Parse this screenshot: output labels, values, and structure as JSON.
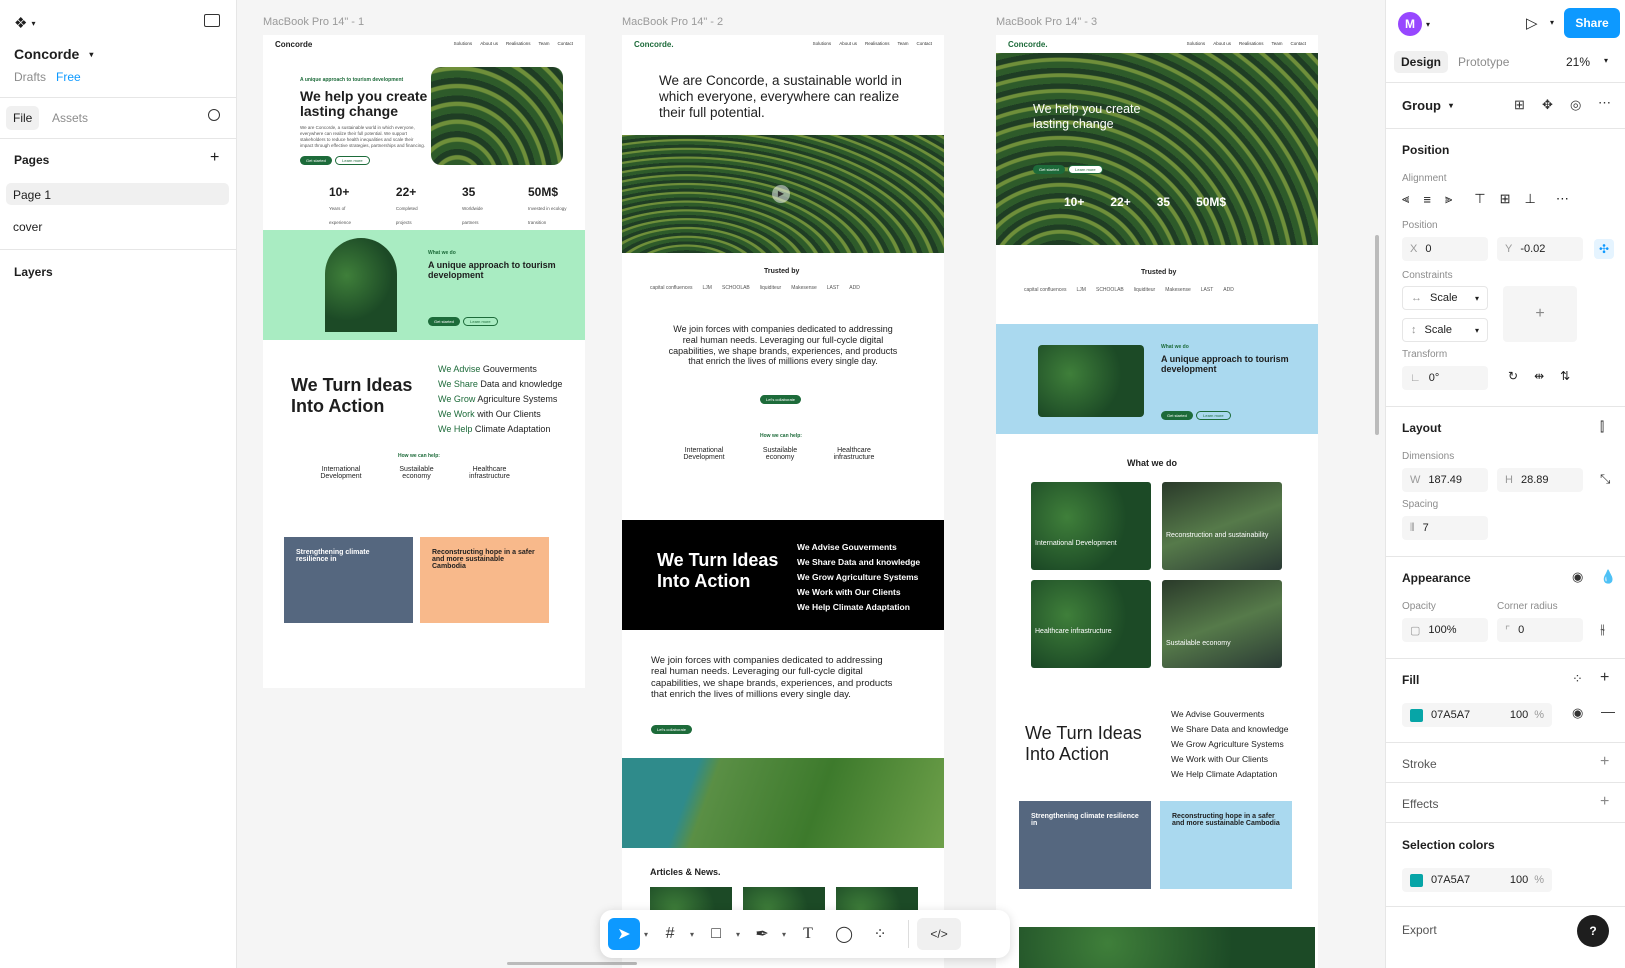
{
  "left_panel": {
    "file_name": "Concorde",
    "drafts": "Drafts",
    "plan": "Free",
    "tabs": [
      "File",
      "Assets"
    ],
    "pages_title": "Pages",
    "pages": [
      "Page 1",
      "cover"
    ],
    "layers_title": "Layers"
  },
  "frames": [
    {
      "label": "MacBook Pro 14\" - 1",
      "logo": "Concorde",
      "nav": [
        "Solutions",
        "About us",
        "Realisations",
        "Team",
        "Contact"
      ],
      "kicker": "A unique approach to tourism development",
      "hero": "We help you create lasting change",
      "body": "We are Concorde, a sustainable world in which everyone, everywhere can realize their full potential. We support stakeholders to reduce health inequalities and scale their impact through effective strategies, partnerships and financing.",
      "btn1": "Get started",
      "btn2": "Learn more",
      "stats": [
        {
          "n": "10+",
          "l": "Years of experience"
        },
        {
          "n": "22+",
          "l": "Completed projects"
        },
        {
          "n": "35",
          "l": "Worldwide partners"
        },
        {
          "n": "50M$",
          "l": "Invested in ecology transition"
        }
      ],
      "what_kicker": "What we do",
      "what_title": "A unique approach to tourism development",
      "ideas_title": "We Turn Ideas Into Action",
      "advise": [
        {
          "k": "We Advise",
          "r": "Gouverments"
        },
        {
          "k": "We Share",
          "r": "Data and knowledge"
        },
        {
          "k": "We Grow",
          "r": "Agriculture Systems"
        },
        {
          "k": "We Work",
          "r": "with Our Clients"
        },
        {
          "k": "We Help",
          "r": "Climate Adaptation"
        }
      ],
      "help_kicker": "How we can help:",
      "cols": [
        "International Development",
        "Sustailable economy",
        "Healthcare infrastructure"
      ],
      "card1": "Strengthening climate resilience in",
      "card2": "Reconstructing hope in a safer and more sustainable Cambodia"
    },
    {
      "label": "MacBook Pro 14\" - 2",
      "logo": "Concorde.",
      "intro": "We are Concorde, a sustainable world in which everyone, everywhere can realize their full potential.",
      "trusted": "Trusted by",
      "brands": [
        "capital confluences",
        "LJM",
        "SCHOOLAB",
        "liquiditeur",
        "Makesense",
        "LAST",
        "ADD"
      ],
      "join": "We join forces with companies dedicated to addressing real human needs. Leveraging our full-cycle digital capabilities, we shape brands, experiences, and products that enrich the lives of millions every single day.",
      "collab": "Let's collaborate",
      "help_kicker": "How we can help:",
      "ideas_title": "We Turn Ideas Into Action",
      "articles": "Articles & News."
    },
    {
      "label": "MacBook Pro 14\" - 3",
      "what_title": "What we do",
      "tiles": [
        "International Development",
        "Reconstruction and sustainability",
        "Healthcare infrastructure",
        "Sustailable economy"
      ]
    }
  ],
  "toolbar": {
    "tools": [
      "move-tool",
      "frame-tool",
      "shape-tool",
      "pen-tool",
      "text-tool",
      "comment-tool",
      "actions-tool",
      "dev-mode-tool"
    ]
  },
  "right_panel": {
    "avatar": "M",
    "share": "Share",
    "tabs": [
      "Design",
      "Prototype"
    ],
    "zoom": "21%",
    "selection": "Group",
    "position_title": "Position",
    "alignment": "Alignment",
    "position_lbl": "Position",
    "x_lbl": "X",
    "x": "0",
    "y_lbl": "Y",
    "y": "-0.02",
    "constraints": "Constraints",
    "c1": "Scale",
    "c2": "Scale",
    "transform": "Transform",
    "rotation": "0°",
    "layout_title": "Layout",
    "dimensions": "Dimensions",
    "w_lbl": "W",
    "w": "187.49",
    "h_lbl": "H",
    "h": "28.89",
    "spacing": "Spacing",
    "spacing_val": "7",
    "appearance": "Appearance",
    "opacity_lbl": "Opacity",
    "opacity": "100%",
    "radius_lbl": "Corner radius",
    "radius": "0",
    "fill_title": "Fill",
    "fill_hex": "07A5A7",
    "fill_pct": "100",
    "pct": "%",
    "stroke": "Stroke",
    "effects": "Effects",
    "sel_colors": "Selection colors",
    "sel_hex": "07A5A7",
    "sel_pct": "100",
    "export": "Export",
    "help": "?"
  },
  "colors": {
    "accent": "#0d99ff",
    "fill": "#07A5A7",
    "brand_green": "#1d6b3a"
  }
}
